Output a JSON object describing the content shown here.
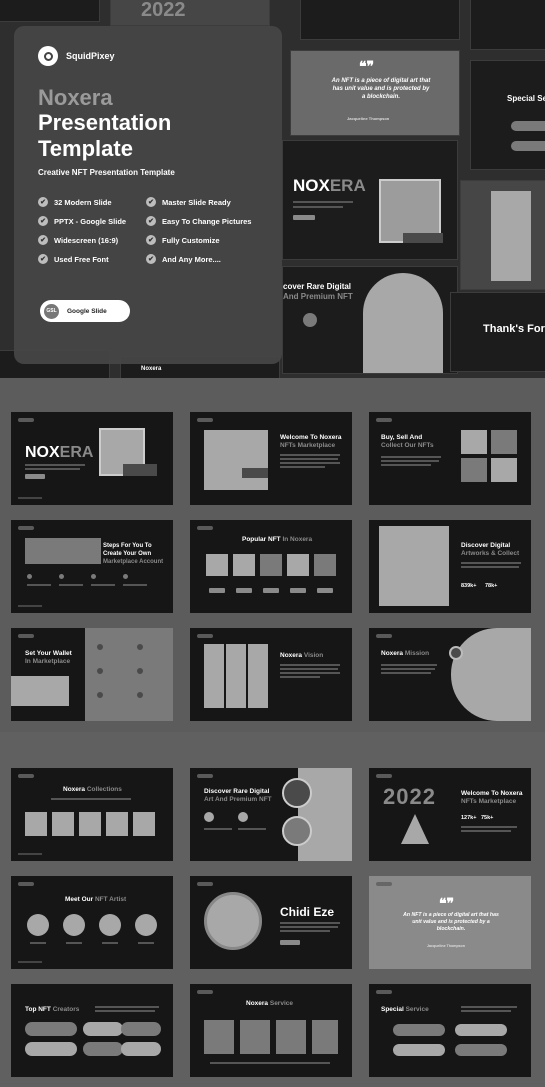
{
  "brand": {
    "name": "SquidPixey"
  },
  "hero": {
    "title_line1": "Noxera",
    "title_line2": "Presentation",
    "title_line3": "Template",
    "subtitle": "Creative NFT Presentation Template",
    "features": [
      "32 Modern Slide",
      "Master Slide Ready",
      "PPTX - Google Slide",
      "Easy To Change Pictures",
      "Widescreen (16:9)",
      "Fully Customize",
      "Used Free Font",
      "And Any More...."
    ],
    "button_icon": "GSL",
    "button_label": "Google Slide"
  },
  "background_slides": {
    "year": "2022",
    "quote": "An NFT is a piece of digital art that has unit value and is protected by a blockchain.",
    "quote_author": "Jacqueline Thompson",
    "cover_title_a": "NOX",
    "cover_title_b": "ERA",
    "discover": "cover Rare Digital",
    "discover_sub": "And Premium NFT",
    "special": "Special Se",
    "thanks": "Thank's For",
    "noxera_small": "Noxera"
  },
  "slides": {
    "s1": {
      "logo_a": "NOX",
      "logo_b": "ERA"
    },
    "s2": {
      "title": "Welcome To Noxera",
      "sub": "NFTs Marketplace"
    },
    "s3": {
      "title": "Buy, Sell And",
      "sub": "Collect Our NFTs"
    },
    "s4": {
      "title1": "Steps For You To",
      "title2": "Create Your Own",
      "sub": "Marketplace Account"
    },
    "s5": {
      "title": "Popular NFT",
      "title_gray": "In Noxera"
    },
    "s6": {
      "title": "Discover Digital",
      "sub": "Artworks & Collect",
      "stat1": "839k+",
      "stat2": "78k+"
    },
    "s7": {
      "title": "Set Your Wallet",
      "sub": "In Marketplace"
    },
    "s8": {
      "title": "Noxera",
      "title_gray": "Vision"
    },
    "s9": {
      "title": "Noxera",
      "title_gray": "Mission"
    },
    "s10": {
      "title": "Noxera",
      "title_gray": "Collections"
    },
    "s11": {
      "title": "Discover Rare Digital",
      "sub": "Art And Premium NFT"
    },
    "s12": {
      "year": "2022",
      "title": "Welcome To Noxera",
      "sub": "NFTs Marketplace",
      "stat1": "127k+",
      "stat2": "75k+"
    },
    "s13": {
      "title": "Meet Our",
      "title_gray": "NFT Artist"
    },
    "s14": {
      "name": "Chidi Eze"
    },
    "s15": {
      "quote": "An NFT is a piece of digital art that has unit value and is protected by a blockchain.",
      "author": "Jacqueline Thompson"
    },
    "s16": {
      "title": "Top NFT",
      "title_gray": "Creators"
    },
    "s17": {
      "title": "Noxera",
      "title_gray": "Service"
    },
    "s18": {
      "title": "Special",
      "title_gray": "Service"
    }
  }
}
